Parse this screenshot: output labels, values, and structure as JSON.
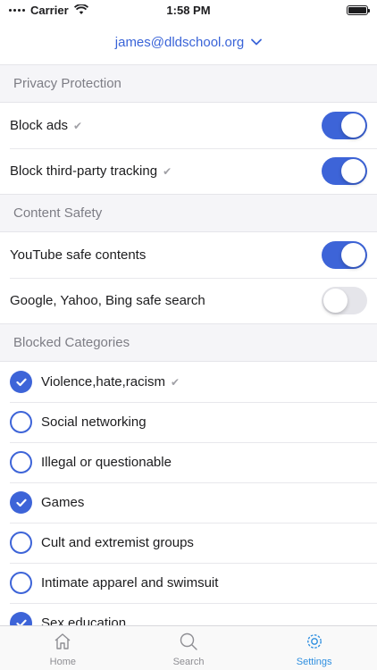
{
  "status_bar": {
    "carrier": "Carrier",
    "time": "1:58 PM"
  },
  "account": {
    "email": "james@dldschool.org",
    "icon": "chevron-down-icon"
  },
  "sections": {
    "privacy": {
      "title": "Privacy Protection",
      "rows": [
        {
          "label": "Block ads",
          "on": true,
          "verified": true
        },
        {
          "label": "Block third-party tracking",
          "on": true,
          "verified": true
        }
      ]
    },
    "content_safety": {
      "title": "Content Safety",
      "rows": [
        {
          "label": "YouTube safe contents",
          "on": true,
          "verified": false
        },
        {
          "label": "Google, Yahoo, Bing safe search",
          "on": false,
          "verified": false
        }
      ]
    },
    "blocked": {
      "title": "Blocked Categories",
      "rows": [
        {
          "label": "Violence,hate,racism",
          "checked": true,
          "verified": true
        },
        {
          "label": "Social networking",
          "checked": false,
          "verified": false
        },
        {
          "label": "Illegal or questionable",
          "checked": false,
          "verified": false
        },
        {
          "label": "Games",
          "checked": true,
          "verified": false
        },
        {
          "label": "Cult and extremist groups",
          "checked": false,
          "verified": false
        },
        {
          "label": "Intimate apparel and swimsuit",
          "checked": false,
          "verified": false
        },
        {
          "label": "Sex education",
          "checked": true,
          "verified": false
        }
      ]
    }
  },
  "tabs": [
    {
      "label": "Home",
      "icon": "home-icon",
      "active": false
    },
    {
      "label": "Search",
      "icon": "search-icon",
      "active": false
    },
    {
      "label": "Settings",
      "icon": "gear-icon",
      "active": true
    }
  ],
  "colors": {
    "accent": "#3d64d8",
    "active_tab": "#2f8fe0"
  }
}
